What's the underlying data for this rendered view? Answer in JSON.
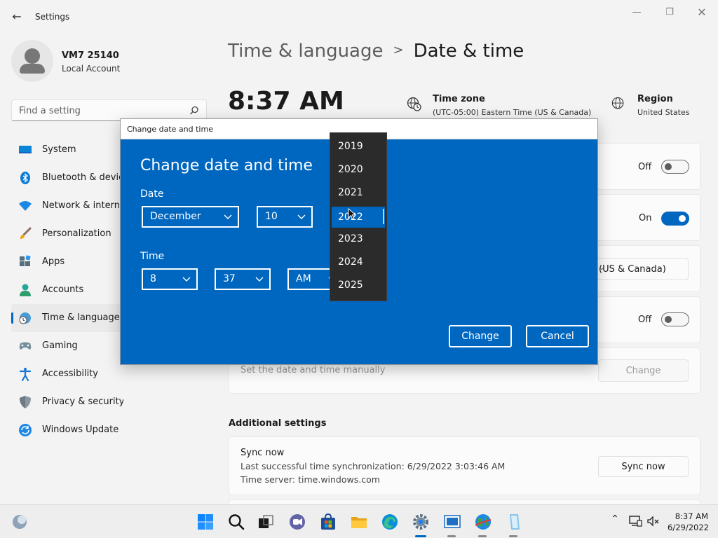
{
  "window": {
    "title": "Settings",
    "back_icon": "back-arrow-icon",
    "controls": [
      "minimize-icon",
      "maximize-icon",
      "close-icon"
    ]
  },
  "profile": {
    "name": "VM7 25140",
    "account_type": "Local Account"
  },
  "search": {
    "placeholder": "Find a setting",
    "icon": "search-icon"
  },
  "sidebar": {
    "items": [
      {
        "label": "System",
        "icon": "monitor-icon",
        "active": false
      },
      {
        "label": "Bluetooth & devices",
        "icon": "bluetooth-icon",
        "active": false
      },
      {
        "label": "Network & internet",
        "icon": "wifi-icon",
        "active": false
      },
      {
        "label": "Personalization",
        "icon": "brush-icon",
        "active": false
      },
      {
        "label": "Apps",
        "icon": "apps-icon",
        "active": false
      },
      {
        "label": "Accounts",
        "icon": "person-icon",
        "active": false
      },
      {
        "label": "Time & language",
        "icon": "globe-clock-icon",
        "active": true
      },
      {
        "label": "Gaming",
        "icon": "gamepad-icon",
        "active": false
      },
      {
        "label": "Accessibility",
        "icon": "accessibility-icon",
        "active": false
      },
      {
        "label": "Privacy & security",
        "icon": "shield-icon",
        "active": false
      },
      {
        "label": "Windows Update",
        "icon": "update-icon",
        "active": false
      }
    ]
  },
  "breadcrumb": {
    "parent": "Time & language",
    "separator": ">",
    "current": "Date & time"
  },
  "header": {
    "clock": "8:37 AM",
    "timezone_label": "Time zone",
    "timezone_value": "(UTC-05:00) Eastern Time (US & Canada)",
    "region_label": "Region",
    "region_value": "United States"
  },
  "settings": {
    "toggle1_state": "Off",
    "toggle2_state": "On",
    "timezone_select": "(US & Canada)",
    "toggle3_state": "Off",
    "manual_label": "Set the date and time manually",
    "manual_button": "Change"
  },
  "additional": {
    "heading": "Additional settings",
    "sync_title": "Sync now",
    "sync_last": "Last successful time synchronization: 6/29/2022 3:03:46 AM",
    "sync_server": "Time server: time.windows.com",
    "sync_button": "Sync now"
  },
  "dialog": {
    "title": "Change date and time",
    "heading": "Change date and time",
    "date_label": "Date",
    "month": "December",
    "day": "10",
    "time_label": "Time",
    "hour": "8",
    "minute": "37",
    "ampm": "AM",
    "change_button": "Change",
    "cancel_button": "Cancel"
  },
  "year_dropdown": {
    "options": [
      "2019",
      "2020",
      "2021",
      "2022",
      "2023",
      "2024",
      "2025"
    ],
    "selected": "2022"
  },
  "colors": {
    "accent": "#0067c0",
    "dialog_bg": "#0067c0",
    "dropdown_bg": "#2b2b2b"
  },
  "taskbar": {
    "icons": [
      "widgets-icon",
      "start-icon",
      "search-icon",
      "task-view-icon",
      "chat-icon",
      "store-icon",
      "file-explorer-icon",
      "edge-icon",
      "settings-icon",
      "remote-desktop-icon",
      "network-globe-icon",
      "notepad-icon"
    ],
    "tray_icons": [
      "chevron-up-icon",
      "display-icon",
      "volume-icon"
    ],
    "time": "8:37 AM",
    "date": "6/29/2022"
  }
}
